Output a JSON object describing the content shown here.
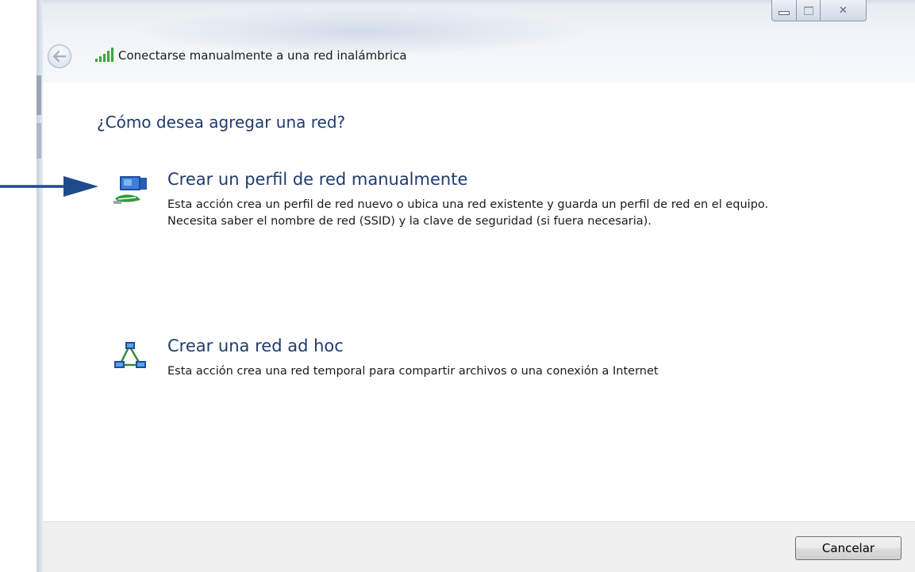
{
  "window": {
    "title": "Conectarse manualmente a una red inalámbrica",
    "controls": {
      "minimize": "minimize-icon",
      "maximize": "maximize-icon",
      "close": "close-icon"
    }
  },
  "main": {
    "question": "¿Cómo desea agregar una red?",
    "options": [
      {
        "title": "Crear un perfil de red manualmente",
        "description": "Esta acción crea un perfil de red nuevo o ubica una red existente y guarda un perfil de red en el equipo. Necesita saber el nombre de red (SSID) y la clave de seguridad (si fuera necesaria).",
        "icon": "network-computer-icon"
      },
      {
        "title": "Crear una red ad hoc",
        "description": "Esta acción crea una red temporal para compartir archivos o una conexión a Internet",
        "icon": "adhoc-network-icon"
      }
    ]
  },
  "footer": {
    "cancel_label": "Cancelar"
  },
  "colors": {
    "heading": "#1f3b6e",
    "pointer_arrow": "#1f4b8a",
    "footer_bg": "#f0f0f0"
  }
}
